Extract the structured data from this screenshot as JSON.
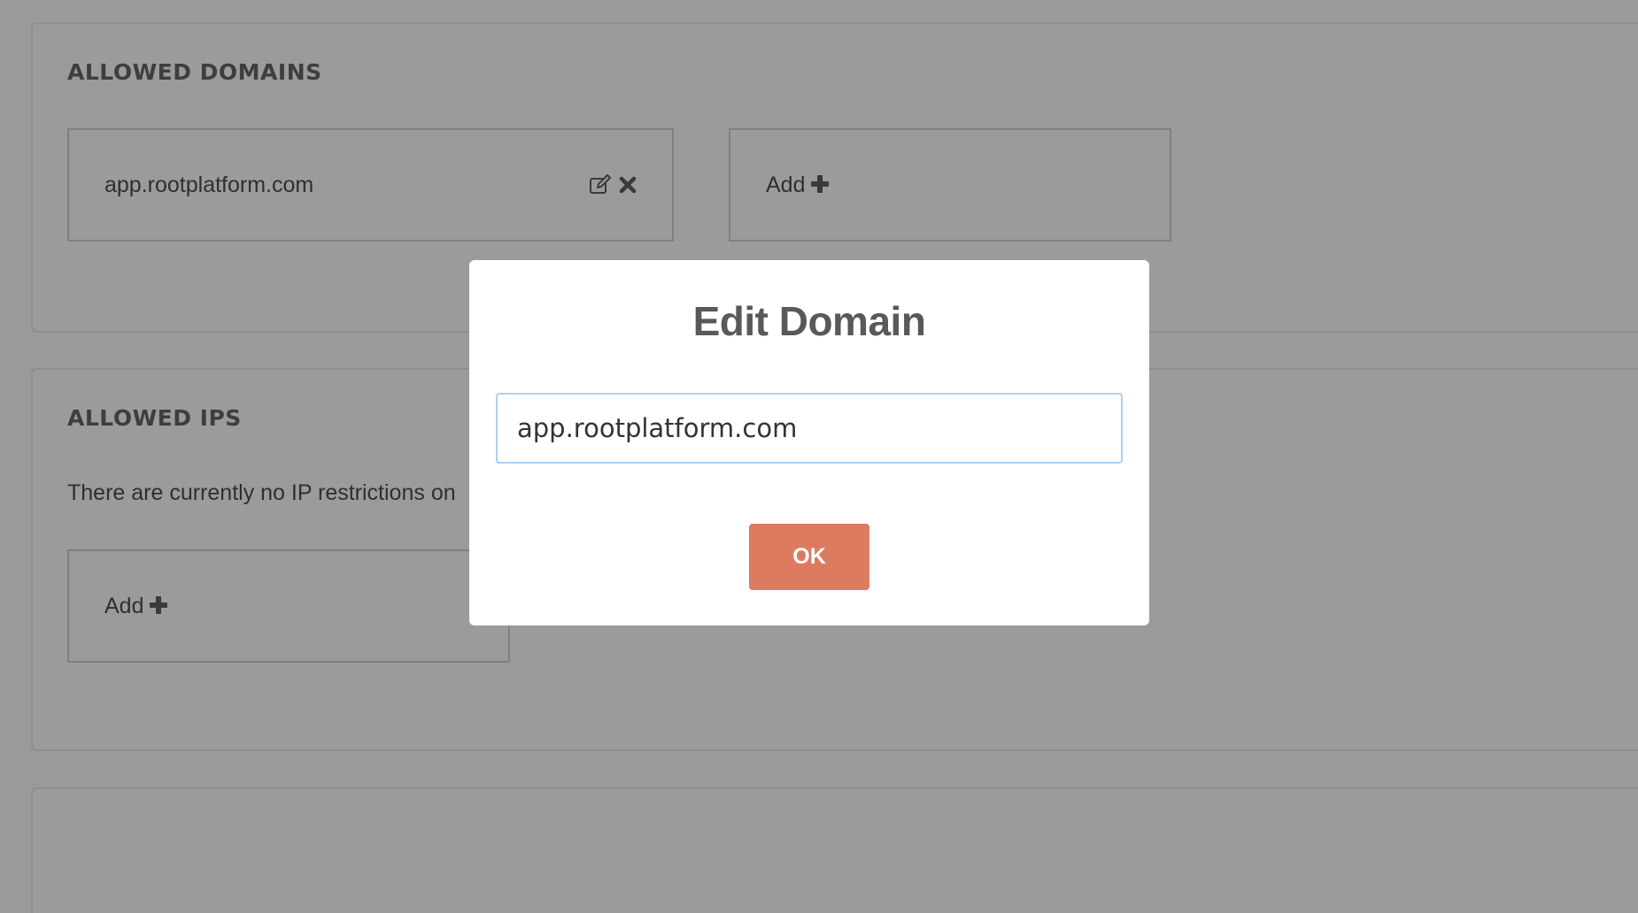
{
  "allowed_domains": {
    "title": "ALLOWED DOMAINS",
    "items": [
      {
        "domain": "app.rootplatform.com",
        "actions": [
          "edit-icon",
          "close-icon"
        ]
      }
    ],
    "add_label": "Add"
  },
  "allowed_ips": {
    "title": "ALLOWED IPS",
    "message": "There are currently no IP restrictions on",
    "add_label": "Add"
  },
  "modal": {
    "title": "Edit Domain",
    "input_value": "app.rootplatform.com",
    "ok_label": "OK"
  },
  "colors": {
    "overlay_background": "#9a9a9a",
    "modal_background": "#ffffff",
    "ok_button": "#dd7b60",
    "input_border": "#a9d2ee",
    "title_text": "#595959"
  },
  "icons": {
    "edit": "edit-icon",
    "remove": "close-icon",
    "add": "plus-icon"
  }
}
